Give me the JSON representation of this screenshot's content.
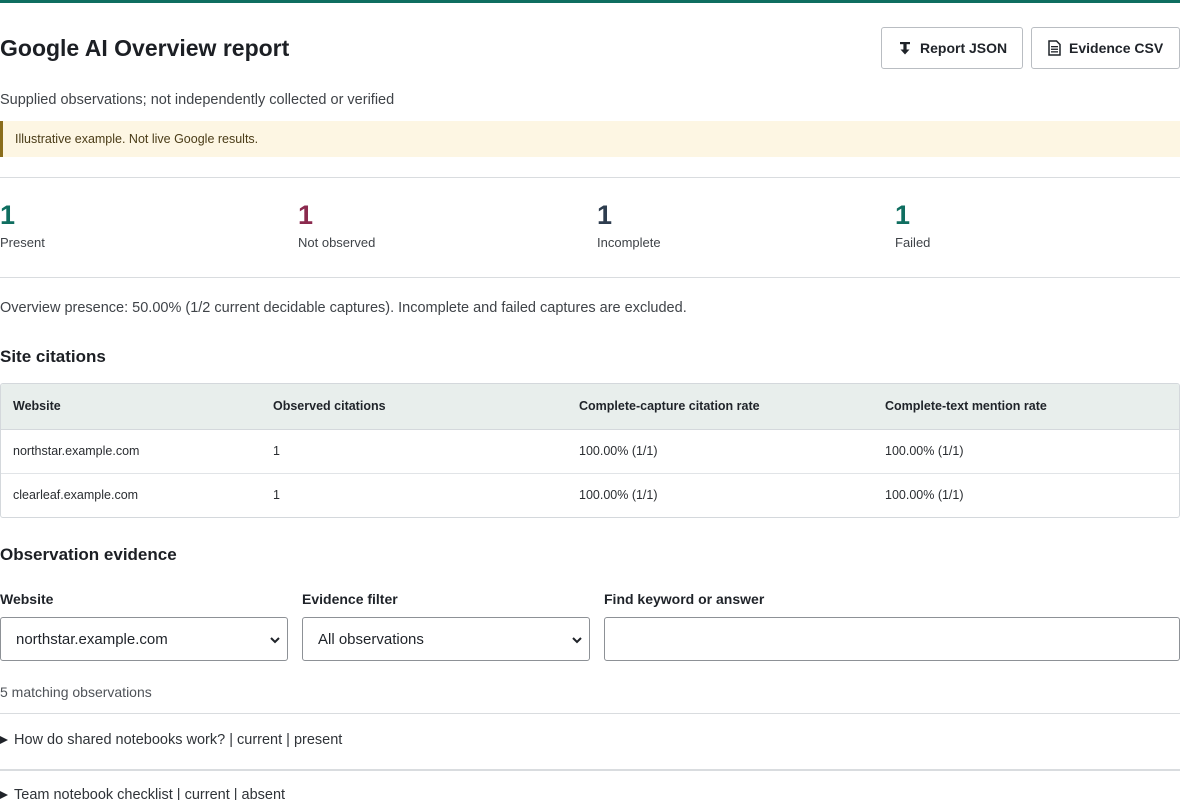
{
  "header": {
    "title": "Google AI Overview report",
    "report_json_label": "Report JSON",
    "evidence_csv_label": "Evidence CSV",
    "subtitle": "Supplied observations; not independently collected or verified"
  },
  "notice": "Illustrative example. Not live Google results.",
  "stats": [
    {
      "value": "1",
      "label": "Present",
      "color": "#0f6e60"
    },
    {
      "value": "1",
      "label": "Not observed",
      "color": "#8b2a4e"
    },
    {
      "value": "1",
      "label": "Incomplete",
      "color": "#2e3d4f"
    },
    {
      "value": "1",
      "label": "Failed",
      "color": "#0f6e60"
    }
  ],
  "presence_text": "Overview presence: 50.00% (1/2 current decidable captures). Incomplete and failed captures are excluded.",
  "site_citations": {
    "title": "Site citations",
    "columns": [
      "Website",
      "Observed citations",
      "Complete-capture citation rate",
      "Complete-text mention rate"
    ],
    "rows": [
      [
        "northstar.example.com",
        "1",
        "100.00% (1/1)",
        "100.00% (1/1)"
      ],
      [
        "clearleaf.example.com",
        "1",
        "100.00% (1/1)",
        "100.00% (1/1)"
      ]
    ]
  },
  "evidence": {
    "title": "Observation evidence",
    "website_label": "Website",
    "website_value": "northstar.example.com",
    "filter_label": "Evidence filter",
    "filter_value": "All observations",
    "find_label": "Find keyword or answer",
    "find_value": "",
    "matching_text": "5 matching observations",
    "items": [
      "How do shared notebooks work? | current | present",
      "Team notebook checklist | current | absent"
    ]
  },
  "colors": {
    "accent": "#0f6e60",
    "notice_bg": "#fdf6e3",
    "notice_border": "#8a6d1c",
    "table_header_bg": "#e8eeec"
  },
  "icons": {
    "report_json": "download-icon",
    "evidence_csv": "document-icon",
    "select": "chevron-down-icon",
    "disclosure": "triangle-right-icon"
  }
}
